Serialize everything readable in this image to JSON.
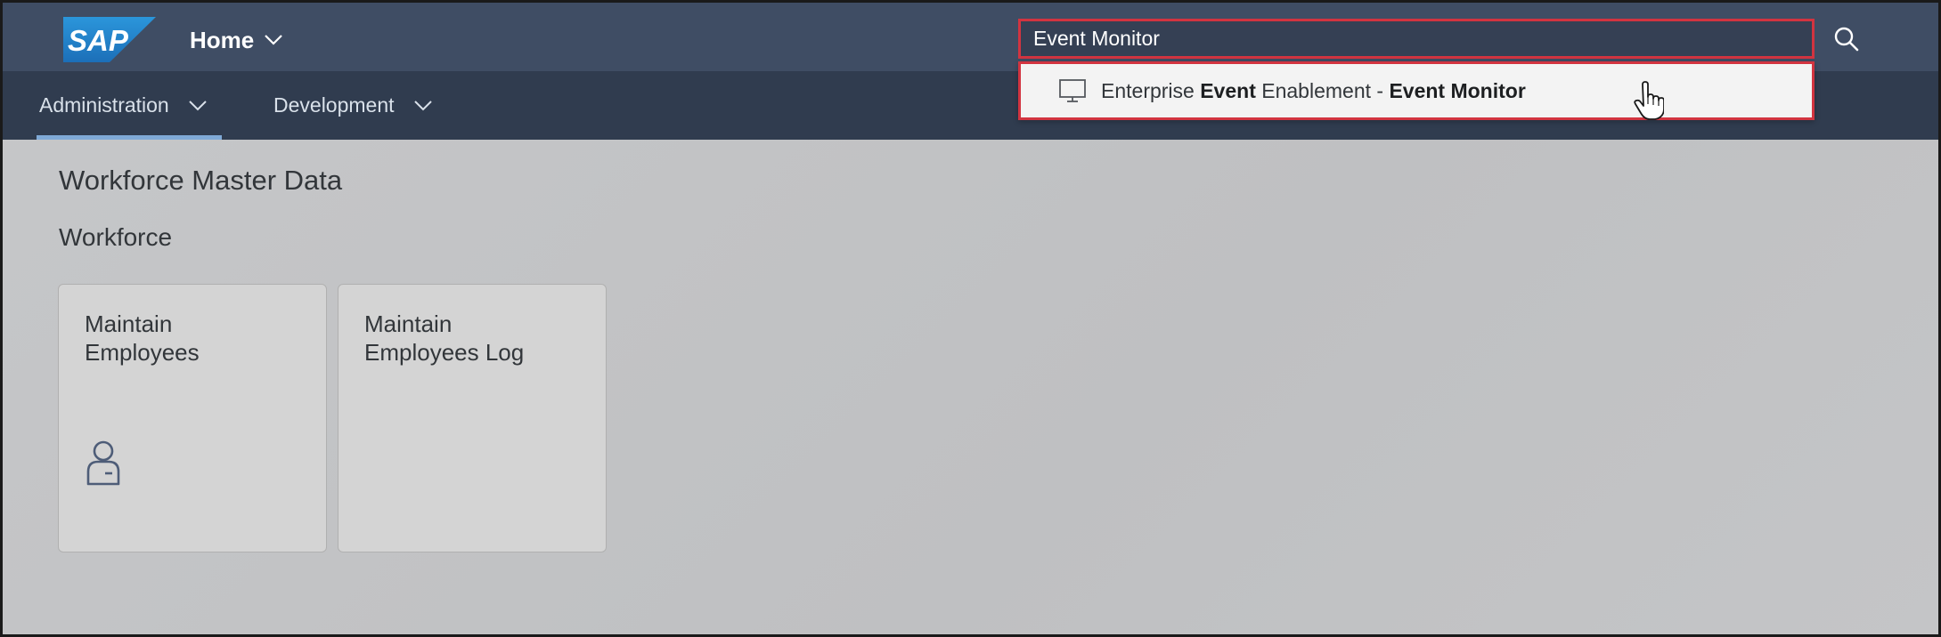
{
  "shell": {
    "logo_text": "SAP",
    "home_label": "Home",
    "search": {
      "value": "Event Monitor"
    }
  },
  "subnav": {
    "items": [
      {
        "label": "Administration",
        "active": true
      },
      {
        "label": "Development",
        "active": false
      }
    ]
  },
  "search_result": {
    "parts": [
      "Enterprise ",
      "Event",
      " Enablement - ",
      "Event Monitor"
    ]
  },
  "content": {
    "title": "Workforce Master Data",
    "group": "Workforce",
    "tiles": [
      {
        "line1": "Maintain",
        "line2": "Employees",
        "icon": "employee-icon"
      },
      {
        "line1": "Maintain",
        "line2": "Employees Log"
      }
    ]
  },
  "colors": {
    "shell_bg": "#3f4d64",
    "subnav_bg": "#303c4f",
    "highlight_border": "#d23440",
    "tile_bg": "#d4d4d4"
  }
}
